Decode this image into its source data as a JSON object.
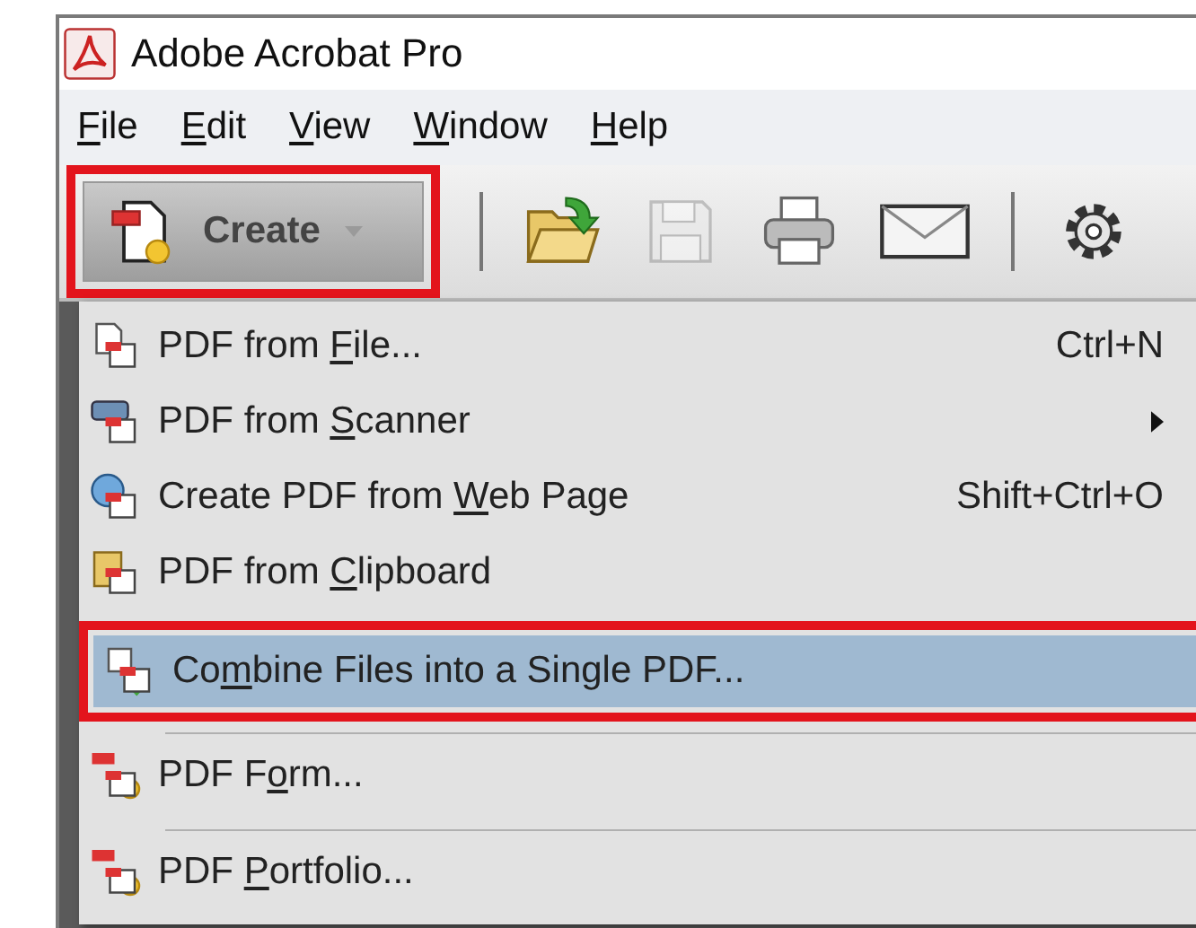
{
  "window": {
    "title": "Adobe Acrobat Pro"
  },
  "menubar": [
    {
      "key": "F",
      "post": "ile"
    },
    {
      "key": "E",
      "post": "dit"
    },
    {
      "key": "V",
      "post": "iew"
    },
    {
      "key": "W",
      "post": "indow"
    },
    {
      "key": "H",
      "post": "elp"
    }
  ],
  "toolbar": {
    "create_button": {
      "label": "Create",
      "highlighted": true
    },
    "tools": [
      {
        "kind": "open",
        "disabled": false
      },
      {
        "kind": "save",
        "disabled": true
      },
      {
        "kind": "print",
        "disabled": false
      },
      {
        "kind": "email",
        "disabled": false
      },
      {
        "kind": "settings",
        "disabled": false
      }
    ]
  },
  "create_menu": [
    {
      "kind": "from-file",
      "pre": "PDF from ",
      "key": "F",
      "post": "ile...",
      "shortcut": "Ctrl+N",
      "submenu": false,
      "selected": false,
      "highlighted": false,
      "separator_before": false
    },
    {
      "kind": "from-scanner",
      "pre": "PDF from ",
      "key": "S",
      "post": "canner",
      "submenu": true,
      "selected": false,
      "highlighted": false,
      "separator_before": false
    },
    {
      "kind": "from-web",
      "pre": "Create PDF from ",
      "key": "W",
      "post": "eb Page",
      "shortcut": "Shift+Ctrl+O",
      "submenu": false,
      "selected": false,
      "highlighted": false,
      "separator_before": false
    },
    {
      "kind": "from-clipboard",
      "pre": "PDF from ",
      "key": "C",
      "post": "lipboard",
      "submenu": false,
      "selected": false,
      "highlighted": false,
      "separator_before": false
    },
    {
      "kind": "combine",
      "pre": "Co",
      "key": "m",
      "post": "bine Files into a Single PDF...",
      "submenu": false,
      "selected": true,
      "highlighted": true,
      "separator_before": false
    },
    {
      "kind": "form",
      "pre": "PDF F",
      "key": "o",
      "post": "rm...",
      "submenu": false,
      "selected": false,
      "highlighted": false,
      "separator_before": true
    },
    {
      "kind": "portfolio",
      "pre": "PDF ",
      "key": "P",
      "post": "ortfolio...",
      "submenu": false,
      "selected": false,
      "highlighted": false,
      "separator_before": true
    }
  ]
}
